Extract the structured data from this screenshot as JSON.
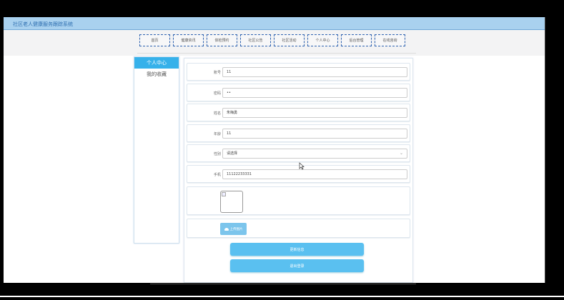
{
  "app": {
    "title": "社区老人健康服务跟踪系统"
  },
  "nav": {
    "items": [
      "首页",
      "健康资讯",
      "体检预约",
      "社区公告",
      "社区活动",
      "个人中心",
      "后台管理",
      "在线咨询"
    ]
  },
  "sidebar": {
    "items": [
      {
        "label": "个人中心",
        "active": true
      },
      {
        "label": "我的收藏",
        "active": false
      }
    ]
  },
  "form": {
    "fields": [
      {
        "label": "账号",
        "value": "11"
      },
      {
        "label": "密码",
        "value": "••"
      },
      {
        "label": "姓名",
        "value": "朱梅勇"
      },
      {
        "label": "年龄",
        "value": "11"
      },
      {
        "label": "性别",
        "value": "请选择"
      },
      {
        "label": "手机",
        "value": "11122233331"
      }
    ],
    "upload_label": "上传图片",
    "update_label": "更新信息",
    "logout_label": "退出登录"
  },
  "colors": {
    "accent": "#36b1ea",
    "titlebar": "#a9d1ef",
    "nav_border": "#2f63b0"
  }
}
